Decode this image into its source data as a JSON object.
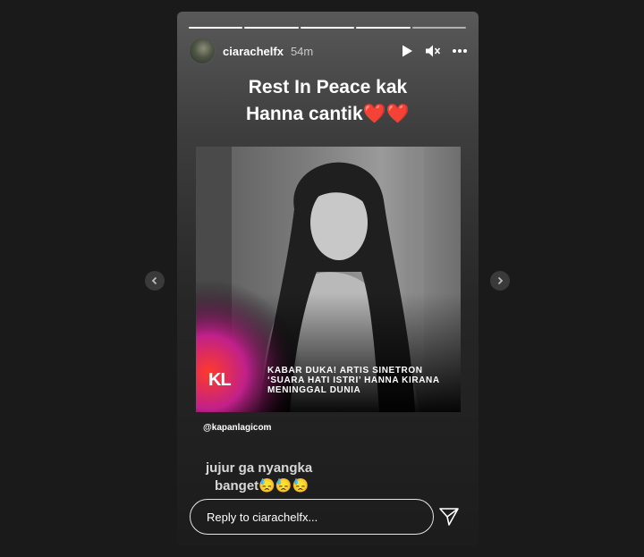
{
  "story": {
    "username": "ciarachelfx",
    "time": "54m",
    "segments_total": 5,
    "segments_done": 4,
    "caption_line1": "Rest In Peace kak",
    "caption_line2": "Hanna cantik❤️❤️"
  },
  "post": {
    "logo": "KL",
    "headline_line1": "KABAR DUKA! ARTIS SINETRON",
    "headline_line2": "‘SUARA HATI ISTRI’ HANNA KIRANA",
    "headline_line3": "MENINGGAL DUNIA",
    "mention": "@kapanlagicom"
  },
  "comment": {
    "line1": "jujur ga nyangka",
    "line2": "banget😓😓😓"
  },
  "reply": {
    "placeholder": "Reply to ciarachelfx..."
  },
  "icons": {
    "play": "play-icon",
    "mute": "mute-icon",
    "more": "more-icon",
    "send": "send-icon",
    "prev": "chevron-left-icon",
    "next": "chevron-right-icon"
  }
}
